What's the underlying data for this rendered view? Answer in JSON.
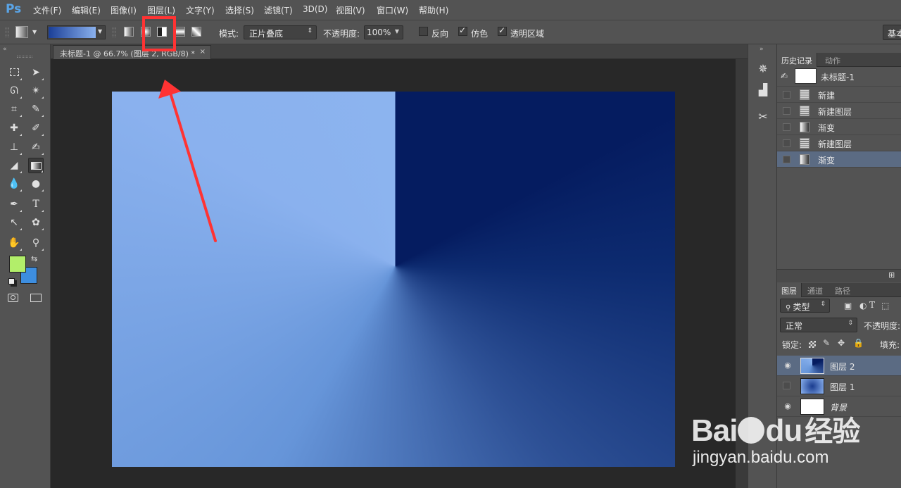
{
  "app": {
    "logo": "Ps"
  },
  "menu": [
    "文件(F)",
    "编辑(E)",
    "图像(I)",
    "图层(L)",
    "文字(Y)",
    "选择(S)",
    "滤镜(T)",
    "3D(D)",
    "视图(V)",
    "窗口(W)",
    "帮助(H)"
  ],
  "options": {
    "mode_label": "模式:",
    "mode_value": "正片叠底",
    "opacity_label": "不透明度:",
    "opacity_value": "100%",
    "reverse_label": "反向",
    "reverse_checked": false,
    "dither_label": "仿色",
    "dither_checked": true,
    "transparency_label": "透明区域",
    "transparency_checked": true,
    "workspace_button": "基本",
    "selected_gradient_type": "angle-gradient"
  },
  "document": {
    "tab_title": "未标题-1 @ 66.7% (图层 2, RGB/8) *",
    "close": "×"
  },
  "history_panel": {
    "tabs": [
      "历史记录",
      "动作"
    ],
    "snapshot": "未标题-1",
    "items": [
      {
        "label": "新建",
        "icon": "document-icon"
      },
      {
        "label": "新建图层",
        "icon": "document-icon"
      },
      {
        "label": "渐变",
        "icon": "gradient-icon"
      },
      {
        "label": "新建图层",
        "icon": "document-icon"
      },
      {
        "label": "渐变",
        "icon": "gradient-icon",
        "selected": true
      }
    ]
  },
  "layers_panel": {
    "tabs": [
      "图层",
      "通道",
      "路径"
    ],
    "filter_label": "类型",
    "blend_mode": "正常",
    "opacity_label": "不透明度:",
    "lock_label": "锁定:",
    "fill_label": "填充:",
    "layers": [
      {
        "name": "图层 2",
        "visible": true,
        "selected": true
      },
      {
        "name": "图层 1",
        "visible": false
      },
      {
        "name": "背景",
        "visible": true
      }
    ]
  },
  "colors": {
    "foreground": "#b2ee6a",
    "background": "#3d8ee0",
    "canvas_light": "#8ab1ee",
    "canvas_dark": "#051c60",
    "annotation": "#ff3333"
  },
  "watermark": {
    "brand": "Bai",
    "brand2": "du",
    "product": "经验",
    "url": "jingyan.baidu.com"
  }
}
